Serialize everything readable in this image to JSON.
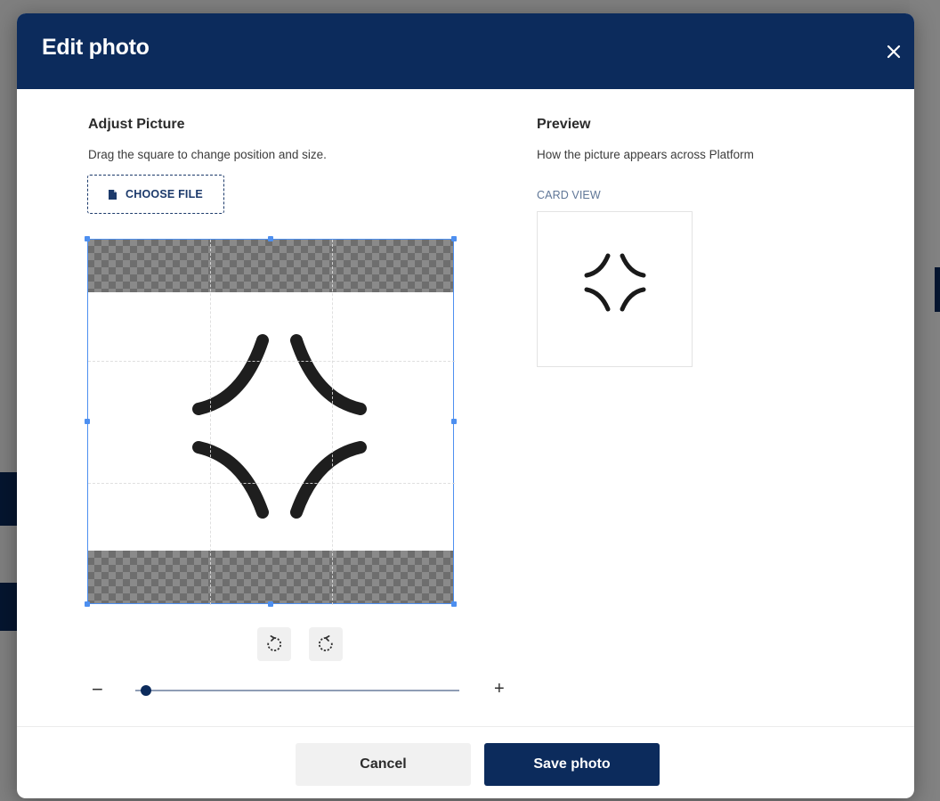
{
  "colors": {
    "header_bg": "#0c2b5c",
    "primary": "#0c2b5c",
    "crop_frame": "#4d8ff0",
    "card_view_label": "#5f7697"
  },
  "modal": {
    "title": "Edit photo",
    "close_icon": "close-icon"
  },
  "adjust": {
    "title": "Adjust Picture",
    "subtitle": "Drag the square to change position and size.",
    "choose_file_label": "CHOOSE FILE",
    "choose_file_icon": "file-icon",
    "rotate_left_icon": "rotate-left-icon",
    "rotate_right_icon": "rotate-right-icon",
    "zoom_minus": "−",
    "zoom_plus": "+",
    "zoom_level": 0
  },
  "preview": {
    "title": "Preview",
    "subtitle": "How the picture appears across Platform",
    "card_view_label": "CARD VIEW"
  },
  "footer": {
    "cancel_label": "Cancel",
    "save_label": "Save photo"
  }
}
